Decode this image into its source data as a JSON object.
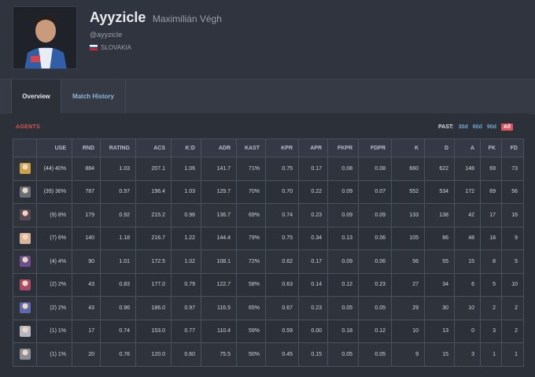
{
  "player": {
    "handle": "Ayyzicle",
    "real_name": "Maximilián Végh",
    "twitter": "@ayyzicle",
    "country": "SLOVAKIA"
  },
  "tabs": [
    {
      "label": "Overview",
      "active": true
    },
    {
      "label": "Match History",
      "active": false
    }
  ],
  "agents_section": {
    "title": "AGENTS",
    "past_label": "PAST:",
    "past_options": [
      "30d",
      "60d",
      "90d",
      "All"
    ],
    "selected_option": "All"
  },
  "columns": [
    "",
    "USE",
    "RND",
    "RATING",
    "ACS",
    "K:D",
    "ADR",
    "KAST",
    "KPR",
    "APR",
    "FKPR",
    "FDPR",
    "K",
    "D",
    "A",
    "FK",
    "FD"
  ],
  "rows": [
    {
      "icon": "agent-icon-1",
      "color": "#c9a24a",
      "cells": [
        "(44) 40%",
        "884",
        "1.03",
        "207.1",
        "1.06",
        "141.7",
        "71%",
        "0.75",
        "0.17",
        "0.08",
        "0.08",
        "660",
        "622",
        "148",
        "69",
        "73"
      ]
    },
    {
      "icon": "agent-icon-2",
      "color": "#6a6f7a",
      "cells": [
        "(39) 36%",
        "787",
        "0.97",
        "196.4",
        "1.03",
        "129.7",
        "70%",
        "0.70",
        "0.22",
        "0.09",
        "0.07",
        "552",
        "534",
        "172",
        "69",
        "56"
      ]
    },
    {
      "icon": "agent-icon-3",
      "color": "#5a4a58",
      "cells": [
        "(9) 8%",
        "179",
        "0.92",
        "215.2",
        "0.96",
        "136.7",
        "69%",
        "0.74",
        "0.23",
        "0.09",
        "0.09",
        "133",
        "138",
        "42",
        "17",
        "16"
      ]
    },
    {
      "icon": "agent-icon-4",
      "color": "#d8b59a",
      "cells": [
        "(7) 6%",
        "140",
        "1.18",
        "216.7",
        "1.22",
        "144.4",
        "79%",
        "0.75",
        "0.34",
        "0.13",
        "0.06",
        "105",
        "86",
        "48",
        "18",
        "9"
      ]
    },
    {
      "icon": "agent-icon-5",
      "color": "#6b4f8f",
      "cells": [
        "(4) 4%",
        "90",
        "1.01",
        "172.5",
        "1.02",
        "108.1",
        "72%",
        "0.62",
        "0.17",
        "0.09",
        "0.06",
        "56",
        "55",
        "15",
        "8",
        "5"
      ]
    },
    {
      "icon": "agent-icon-6",
      "color": "#a84a6a",
      "cells": [
        "(2) 2%",
        "43",
        "0.83",
        "177.0",
        "0.79",
        "122.7",
        "58%",
        "0.63",
        "0.14",
        "0.12",
        "0.23",
        "27",
        "34",
        "6",
        "5",
        "10"
      ]
    },
    {
      "icon": "agent-icon-7",
      "color": "#5d6ab0",
      "cells": [
        "(2) 2%",
        "43",
        "0.96",
        "186.0",
        "0.97",
        "116.5",
        "65%",
        "0.67",
        "0.23",
        "0.05",
        "0.05",
        "29",
        "30",
        "10",
        "2",
        "2"
      ]
    },
    {
      "icon": "agent-icon-8",
      "color": "#b7b9c0",
      "cells": [
        "(1) 1%",
        "17",
        "0.74",
        "153.0",
        "0.77",
        "110.4",
        "59%",
        "0.59",
        "0.00",
        "0.18",
        "0.12",
        "10",
        "13",
        "0",
        "3",
        "2"
      ]
    },
    {
      "icon": "agent-icon-9",
      "color": "#8a8f9a",
      "cells": [
        "(1) 1%",
        "20",
        "0.76",
        "120.0",
        "0.60",
        "75.5",
        "50%",
        "0.45",
        "0.15",
        "0.05",
        "0.05",
        "9",
        "15",
        "3",
        "1",
        "1"
      ]
    }
  ]
}
